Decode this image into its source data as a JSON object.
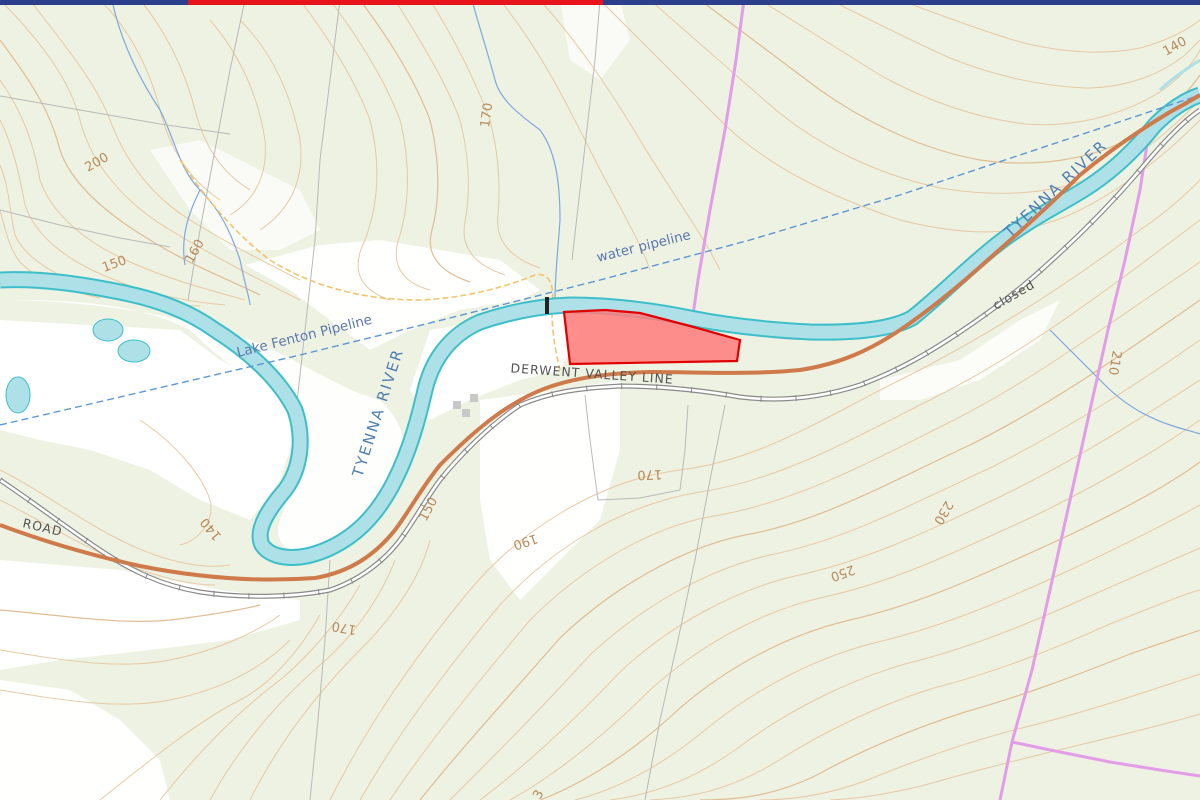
{
  "map": {
    "labels": {
      "river_west": "TYENNA RIVER",
      "river_east": "TYENNA RIVER",
      "pipeline": "Lake Fenton Pipeline",
      "water_pipeline": "water pipeline",
      "railway": "DERWENT VALLEY LINE",
      "railway_status": "closed",
      "road": "ROAD"
    },
    "contour_labels": {
      "c200": "200",
      "c150": "150",
      "c160": "160",
      "c170_top": "170",
      "c140_ne": "140",
      "c210": "210",
      "c230": "230",
      "c250": "250",
      "c170_mid": "170",
      "c190": "190",
      "c150_road": "150",
      "c140_sw": "140",
      "c170_south": "170",
      "c_cut": "3"
    },
    "colors": {
      "river": "#aee0e8",
      "river_outline": "#3dbfc9",
      "road": "#cf7a4a",
      "railway": "#8a8a8a",
      "pipeline": "#5d96d6",
      "boundary": "#e39ce8",
      "track": "#f2c46e",
      "parcel_fill": "#ff7b7b",
      "parcel_stroke": "#e00000",
      "vegetation": "#eef2e2",
      "cleared": "#ffffff",
      "contour": "#e0bd93",
      "top_bar": "#2b3f8c",
      "top_bar_accent": "#e8141b"
    }
  }
}
